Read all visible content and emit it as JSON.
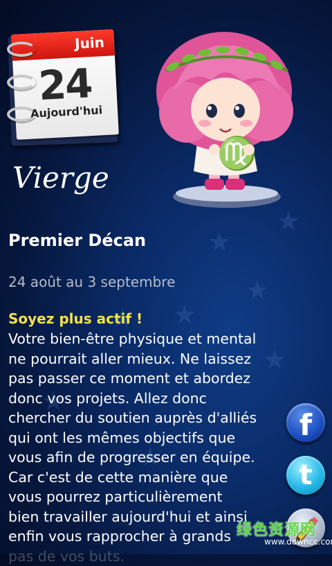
{
  "calendar": {
    "month": "Juin",
    "day": "24",
    "label": "Aujourd'hui"
  },
  "sign": {
    "name": "Vierge",
    "symbol": "♍"
  },
  "decan": {
    "title": "Premier Décan",
    "date_range": "24 août au 3 septembre"
  },
  "horoscope": {
    "headline": "Soyez plus actif !",
    "lines": [
      "Votre bien-être physique et mental",
      "ne pourrait aller mieux. Ne laissez",
      "pas passer ce moment et abordez",
      "donc vos projets. Allez donc",
      "chercher du soutien auprès d'alliés",
      "qui ont les mêmes objectifs que",
      "vous afin de progresser en équipe.",
      "Car c'est de cette manière que",
      "vous pourrez particulièrement",
      "bien travailler aujourd'hui et ainsi",
      "enfin vous rapprocher à grands",
      "pas de vos buts."
    ]
  },
  "share": {
    "facebook_icon": "facebook-icon",
    "facebook_glyph": "f",
    "twitter_icon": "twitter-icon",
    "twitter_glyph": "t",
    "edit_icon": "pencil-icon"
  },
  "watermark": {
    "site_cn": "绿色资源网",
    "url": "www.downcc.com"
  },
  "colors": {
    "headline": "#f5e04a",
    "dates": "#b8bdca",
    "calendar_red": "#e0241a",
    "background": "#0a2a66"
  }
}
